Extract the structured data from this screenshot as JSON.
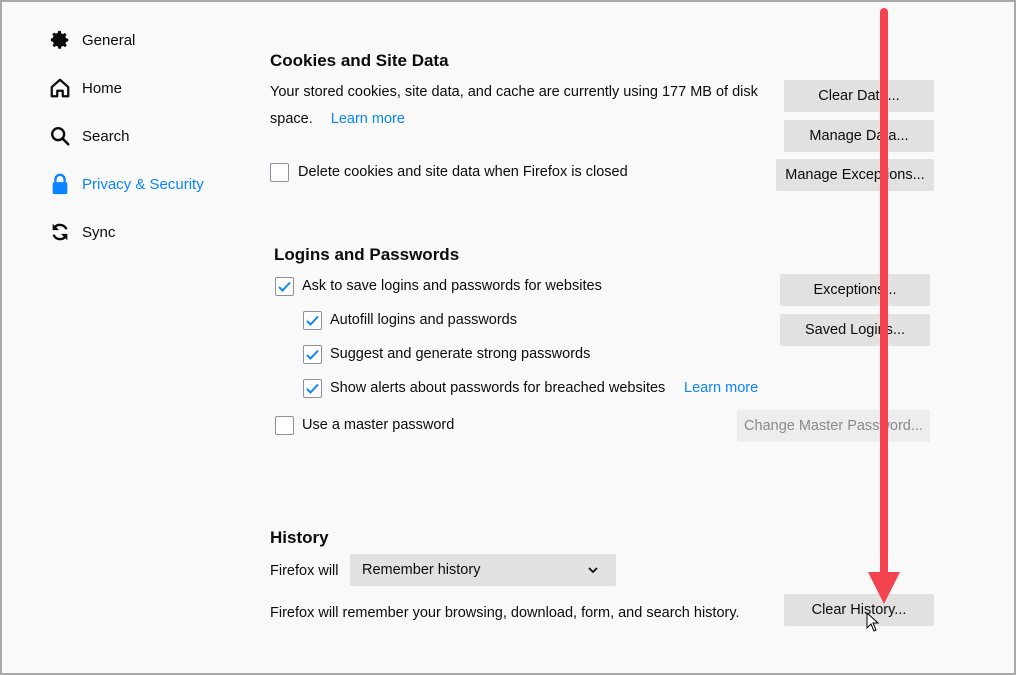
{
  "sidebar": {
    "items": [
      {
        "label": "General",
        "icon": "gear-icon"
      },
      {
        "label": "Home",
        "icon": "home-icon"
      },
      {
        "label": "Search",
        "icon": "search-icon"
      },
      {
        "label": "Privacy & Security",
        "icon": "lock-icon",
        "selected": true
      },
      {
        "label": "Sync",
        "icon": "sync-icon"
      }
    ]
  },
  "cookies": {
    "title": "Cookies and Site Data",
    "description_line1": "Your stored cookies, site data, and cache are currently using 177 MB of disk",
    "description_line2": "space.",
    "learn_more": "Learn more",
    "delete_checkbox_label": "Delete cookies and site data when Firefox is closed",
    "delete_checked": false,
    "clear_data_button": "Clear Data...",
    "manage_data_button": "Manage Data...",
    "manage_exceptions_button": "Manage Exceptions..."
  },
  "logins": {
    "title": "Logins and Passwords",
    "ask_save_label": "Ask to save logins and passwords for websites",
    "autofill_label": "Autofill logins and passwords",
    "suggest_label": "Suggest and generate strong passwords",
    "alerts_label": "Show alerts about passwords for breached websites",
    "alerts_learn_more": "Learn more",
    "master_password_label": "Use a master password",
    "exceptions_button": "Exceptions...",
    "saved_logins_button": "Saved Logins...",
    "change_master_button": "Change Master Password..."
  },
  "history": {
    "title": "History",
    "firefox_will_label": "Firefox will",
    "select_value": "Remember history",
    "description": "Firefox will remember your browsing, download, form, and search history.",
    "clear_history_button": "Clear History..."
  },
  "colors": {
    "accent": "#0a84ff",
    "annotation_arrow": "#f2434f"
  }
}
